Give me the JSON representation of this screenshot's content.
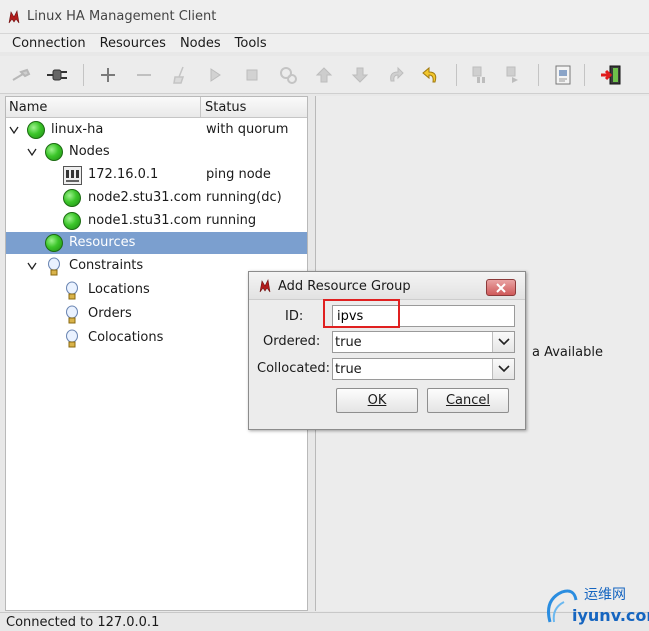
{
  "window": {
    "title": "Linux HA Management Client"
  },
  "menubar": {
    "items": [
      "Connection",
      "Resources",
      "Nodes",
      "Tools"
    ]
  },
  "toolbar": {
    "buttons": [
      "disconnect-icon",
      "connect-icon",
      "add-icon",
      "remove-icon",
      "cleanup-icon",
      "start-icon",
      "stop-icon",
      "default-icon",
      "move-up-icon",
      "move-down-icon",
      "redo-icon",
      "undo-icon",
      "standby-icon",
      "active-icon",
      "view-xml-icon",
      "exit-icon"
    ]
  },
  "tree": {
    "columns": {
      "name": "Name",
      "status": "Status"
    },
    "rows": [
      {
        "label": "linux-ha",
        "status": "with quorum"
      },
      {
        "label": "Nodes",
        "status": ""
      },
      {
        "label": "172.16.0.1",
        "status": "ping node"
      },
      {
        "label": "node2.stu31.com",
        "status": "running(dc)"
      },
      {
        "label": "node1.stu31.com",
        "status": "running"
      },
      {
        "label": "Resources",
        "status": ""
      },
      {
        "label": "Constraints",
        "status": ""
      },
      {
        "label": "Locations",
        "status": ""
      },
      {
        "label": "Orders",
        "status": ""
      },
      {
        "label": "Colocations",
        "status": ""
      }
    ]
  },
  "right_pane": {
    "partial_text": "a Available"
  },
  "statusbar": {
    "text": "Connected to 127.0.0.1"
  },
  "dialog": {
    "title": "Add Resource Group",
    "id_label": "ID:",
    "id_value": "ipvs",
    "ordered_label": "Ordered:",
    "ordered_value": "true",
    "collocated_label": "Collocated:",
    "collocated_value": "true",
    "ok_label": "OK",
    "cancel_label": "Cancel"
  },
  "watermark": {
    "line1": "运维网",
    "line2": "iyunv.com"
  },
  "colors": {
    "selection": "#7b9fcf",
    "node_ok": "#3cc62a",
    "highlight": "#e02020",
    "close": "#cf5a5a"
  }
}
